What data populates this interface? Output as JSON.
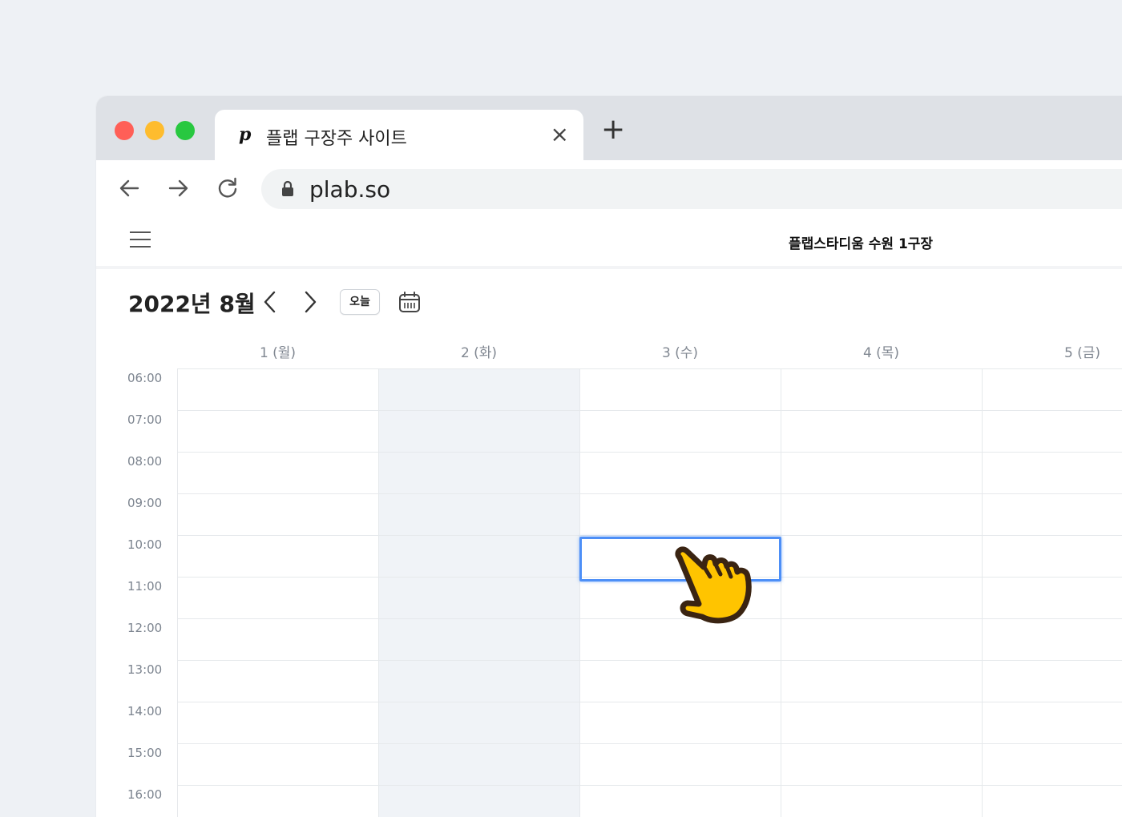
{
  "browser": {
    "tab_title": "플랩 구장주 사이트",
    "tab_favicon": "p",
    "tab_close": "×",
    "new_tab": "+",
    "url": "plab.so"
  },
  "app": {
    "venue_name": "플랩스타디움 수원 1구장"
  },
  "calendar": {
    "month_title": "2022년 8월",
    "today_label": "오늘",
    "days": [
      "1 (월)",
      "2 (화)",
      "3 (수)",
      "4 (목)",
      "5 (금)"
    ],
    "times": [
      "06:00",
      "07:00",
      "08:00",
      "09:00",
      "10:00",
      "11:00",
      "12:00",
      "13:00",
      "14:00",
      "15:00",
      "16:00"
    ],
    "highlighted_day": "2 (화)",
    "selected_slot": {
      "day": "3 (수)",
      "time": "10:00"
    }
  },
  "colors": {
    "accent_blue": "#4d8ff7",
    "cursor_yellow": "#ffc400",
    "shade": "#f0f3f7"
  },
  "icons": {
    "back": "arrow-left-icon",
    "forward": "arrow-right-icon",
    "reload": "reload-icon",
    "lock": "lock-icon",
    "menu": "hamburger-menu-icon",
    "calendar": "calendar-icon",
    "cursor": "pointing-hand-cursor-icon"
  }
}
